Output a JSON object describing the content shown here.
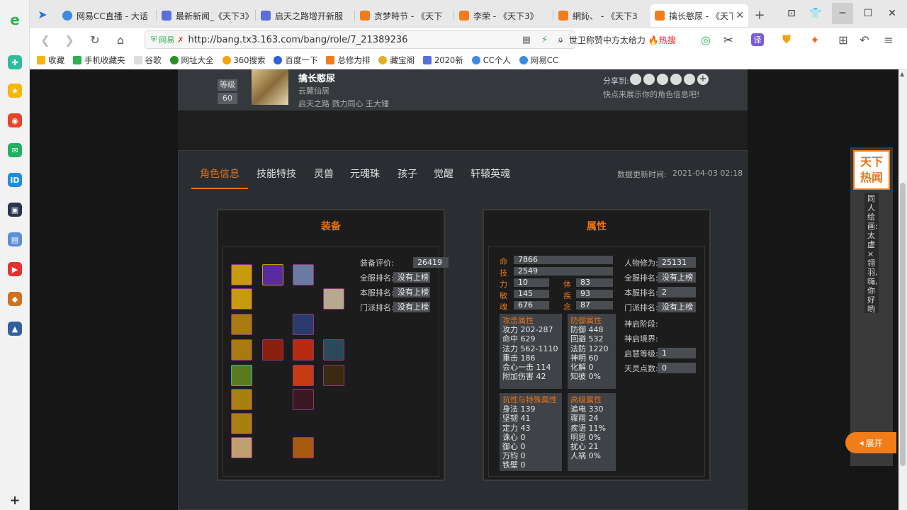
{
  "browser": {
    "tabs": [
      {
        "label": "网易CC直播 - 大话",
        "icon": "cc-icon"
      },
      {
        "label": "最新新闻_《天下3》",
        "icon": "news-icon"
      },
      {
        "label": "启天之路增开新服",
        "icon": "news-icon"
      },
      {
        "label": "贪梦時节 - 《天下",
        "icon": "tx3-icon"
      },
      {
        "label": "李荣 - 《天下3》",
        "icon": "tx3-icon"
      },
      {
        "label": "網鈊、 - 《天下3",
        "icon": "tx3-icon"
      },
      {
        "label": "擒长憨尿 - 《天下",
        "icon": "tx3-icon",
        "active": true
      }
    ],
    "new_tab": "+",
    "url_prefix": "网易",
    "url": "http://bang.tx3.163.com/bang/role/7_21389236",
    "search_text": "世卫称赞中方太给力",
    "search_hot": "🔥热搜",
    "bookmarks": [
      "收藏",
      "手机收藏夹",
      "谷歌",
      "网址大全",
      "360搜索",
      "百度一下",
      "总修为排",
      "藏宝阁",
      "2020新",
      "CC个人",
      "网易CC"
    ]
  },
  "profile": {
    "level_label": "等级",
    "level": "60",
    "name": "擒长憨尿",
    "sect": "云麓仙居",
    "server_guild": "启天之路 戮力同心 王大锤",
    "share_label": "分享到:",
    "share_hint": "快点来展示你的角色信息吧!"
  },
  "tabs": [
    "角色信息",
    "技能特技",
    "灵兽",
    "元魂珠",
    "孩子",
    "觉醒",
    "轩辕英魂"
  ],
  "update_label": "数据更新时间:",
  "update_time": "2021-04-03 02:18",
  "equipment": {
    "title": "装备",
    "rows": [
      {
        "label": "装备评价:",
        "value": "26419"
      },
      {
        "label": "全服排名:",
        "value": "没有上榜"
      },
      {
        "label": "本服排名:",
        "value": "没有上榜"
      },
      {
        "label": "门派排名:",
        "value": "没有上榜"
      }
    ]
  },
  "attributes": {
    "title": "属性",
    "hp_key": "命",
    "hp": "7866",
    "skill_key": "技",
    "skill": "2549",
    "stats_left": [
      {
        "k": "力",
        "v": "10"
      },
      {
        "k": "敏",
        "v": "145"
      },
      {
        "k": "魂",
        "v": "676"
      }
    ],
    "stats_right": [
      {
        "k": "体",
        "v": "83"
      },
      {
        "k": "疾",
        "v": "93"
      },
      {
        "k": "念",
        "v": "87"
      }
    ],
    "attack": {
      "title": "攻击属性",
      "lines": [
        "攻力 202-287",
        "命中 629",
        "法力 562-1110",
        "重击 186",
        "会心一击 114",
        "附加伤害 42"
      ]
    },
    "defense": {
      "title": "防御属性",
      "lines": [
        "防御 448",
        "回避 532",
        "法防 1220",
        "神明 60",
        "化解 0",
        "知彼 0%"
      ]
    },
    "resist": {
      "title": "抗性与特殊属性",
      "lines": [
        "身法 139",
        "坚韧 41",
        "定力 43",
        "诛心 0",
        "御心 0",
        "万钧 0",
        "铁壁 0"
      ]
    },
    "advanced": {
      "title": "高级属性",
      "lines": [
        "追电 330",
        "骤雨 24",
        "疾语 11%",
        "明思 0%",
        "扰心 21",
        "人祸 0%"
      ]
    },
    "side": [
      {
        "label": "人物修为:",
        "value": "25131"
      },
      {
        "label": "全服排名:",
        "value": "没有上榜"
      },
      {
        "label": "本服排名:",
        "value": "2"
      },
      {
        "label": "门派排名:",
        "value": "没有上榜"
      },
      {
        "label": "神启阶段:",
        "value": ""
      },
      {
        "label": "神启境界:",
        "value": ""
      },
      {
        "label": "启慧等级:",
        "value": "1"
      },
      {
        "label": "天灵点数:",
        "value": "0"
      }
    ]
  },
  "news": {
    "title1": "天下",
    "title2": "热闻",
    "text": "同人绘画:太虚×翎羽,嗨,你好哟"
  },
  "expand_label": "展开"
}
